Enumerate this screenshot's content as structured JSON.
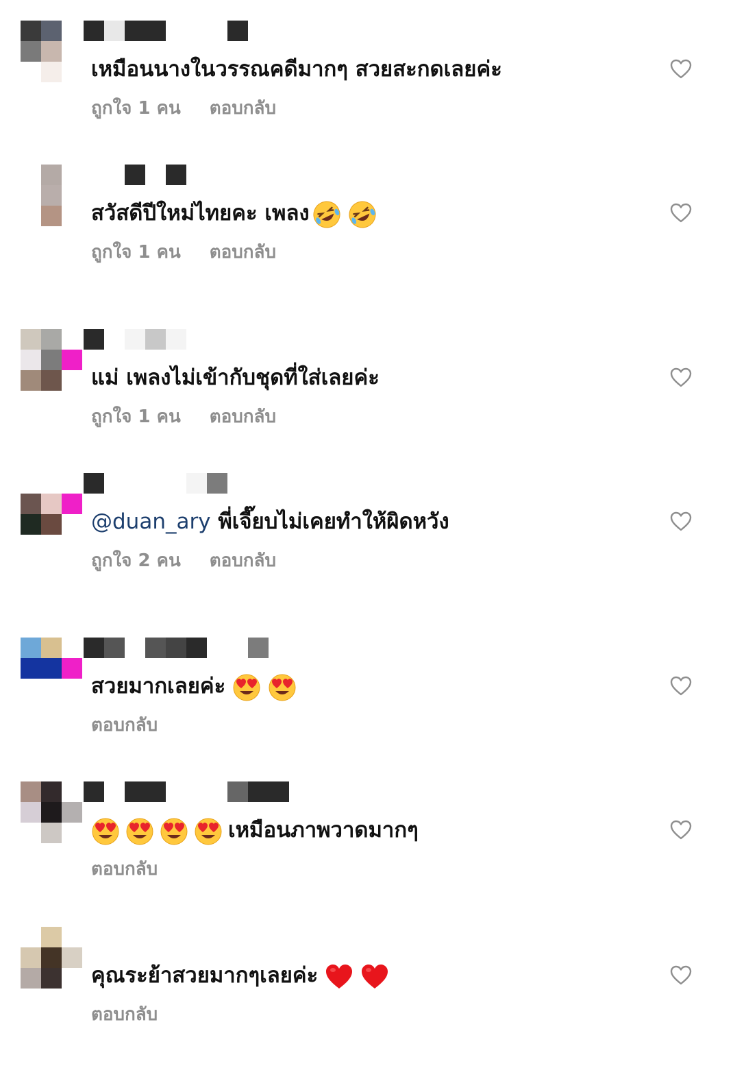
{
  "labels": {
    "reply": "ตอบกลับ"
  },
  "comments": [
    {
      "text": "เหมือนนางในวรรณคดีมากๆ สวยสะกดเลยค่ะ",
      "mention": "",
      "emoji": "",
      "emoji_count": 0,
      "likes": "ถูกใจ 1 คน",
      "reply": "ตอบกลับ",
      "avatar_colors": [
        "#3a3a3a",
        "#5c6270",
        "#ffffff",
        "#7a7a7a",
        "#c8b7ae",
        "#ffffff",
        "#ffffff",
        "#f5eeea",
        "#ffffff"
      ],
      "username_colors": [
        "#2a2a2a",
        "#e8e8e8",
        "#2a2a2a",
        "#2a2a2a",
        "#ffffff",
        "#ffffff",
        "#ffffff",
        "#2a2a2a"
      ]
    },
    {
      "text": "สวัสดีปีใหม่ไทยคะ เพลง",
      "mention": "",
      "emoji": "rofl",
      "emoji_count": 2,
      "likes": "ถูกใจ 1 คน",
      "reply": "ตอบกลับ",
      "avatar_colors": [
        "#ffffff",
        "#b4aaa6",
        "#ffffff",
        "#ffffff",
        "#b9aeab",
        "#ffffff",
        "#ffffff",
        "#b49484",
        "#ffffff"
      ],
      "username_colors": [
        "#ffffff",
        "#ffffff",
        "#2a2a2a",
        "#ffffff",
        "#2a2a2a"
      ]
    },
    {
      "text": "แม่ เพลงไม่เข้ากับชุดที่ใส่เลยค่ะ",
      "mention": "",
      "emoji": "",
      "emoji_count": 0,
      "likes": "ถูกใจ 1 คน",
      "reply": "ตอบกลับ",
      "avatar_colors": [
        "#cfc8bd",
        "#a9a9a6",
        "#ffffff",
        "#ebe7ea",
        "#7c7c7c",
        "#ef20c8",
        "#a08a7a",
        "#6e564c",
        "#ffffff"
      ],
      "username_colors": [
        "#2a2a2a",
        "#ffffff",
        "#f4f4f4",
        "#c8c8c8",
        "#f4f4f4"
      ]
    },
    {
      "text": "พี่เจี๊ยบไม่เคยทำให้ผิดหวัง",
      "mention": "@duan_ary",
      "emoji": "",
      "emoji_count": 0,
      "likes": "ถูกใจ 2 คน",
      "reply": "ตอบกลับ",
      "avatar_colors": [
        "#ffffff",
        "#ffffff",
        "#ffffff",
        "#6b5550",
        "#e6c8c4",
        "#ef20c8",
        "#1f2a22",
        "#6a4a40",
        "#ffffff"
      ],
      "username_colors": [
        "#2a2a2a",
        "#ffffff",
        "#ffffff",
        "#ffffff",
        "#ffffff",
        "#f4f4f4",
        "#7c7c7c"
      ]
    },
    {
      "text": "สวยมากเลยค่ะ",
      "mention": "",
      "emoji": "heart-eyes",
      "emoji_count": 2,
      "likes": "",
      "reply": "ตอบกลับ",
      "avatar_colors": [
        "#6ea8d8",
        "#d8c090",
        "#ffffff",
        "#1434a0",
        "#1434a0",
        "#ef20c8",
        "#ffffff",
        "#ffffff",
        "#ffffff"
      ],
      "username_colors": [
        "#2a2a2a",
        "#555555",
        "#ffffff",
        "#555555",
        "#444444",
        "#2a2a2a",
        "#ffffff",
        "#ffffff",
        "#7c7c7c"
      ]
    },
    {
      "text": "เหมือนภาพวาดมากๆ",
      "mention": "",
      "emoji": "heart-eyes",
      "emoji_count": 4,
      "emoji_first": true,
      "likes": "",
      "reply": "ตอบกลับ",
      "avatar_colors": [
        "#a88e84",
        "#332a2c",
        "#ffffff",
        "#d6ced6",
        "#1e1a1c",
        "#b4b0b0",
        "#ffffff",
        "#cdc8c4",
        "#ffffff"
      ],
      "username_colors": [
        "#2a2a2a",
        "#ffffff",
        "#2a2a2a",
        "#2a2a2a",
        "#ffffff",
        "#ffffff",
        "#ffffff",
        "#666666",
        "#2a2a2a",
        "#2a2a2a"
      ]
    },
    {
      "text": "คุณระย้าสวยมากๆเลยค่ะ",
      "mention": "",
      "emoji": "red-heart",
      "emoji_count": 2,
      "likes": "",
      "reply": "ตอบกลับ",
      "avatar_colors": [
        "#ffffff",
        "#dccaa6",
        "#ffffff",
        "#d6c8b0",
        "#443426",
        "#d8d0c4",
        "#b4aaa6",
        "#3c3230",
        "#ffffff"
      ],
      "username_colors": []
    }
  ]
}
